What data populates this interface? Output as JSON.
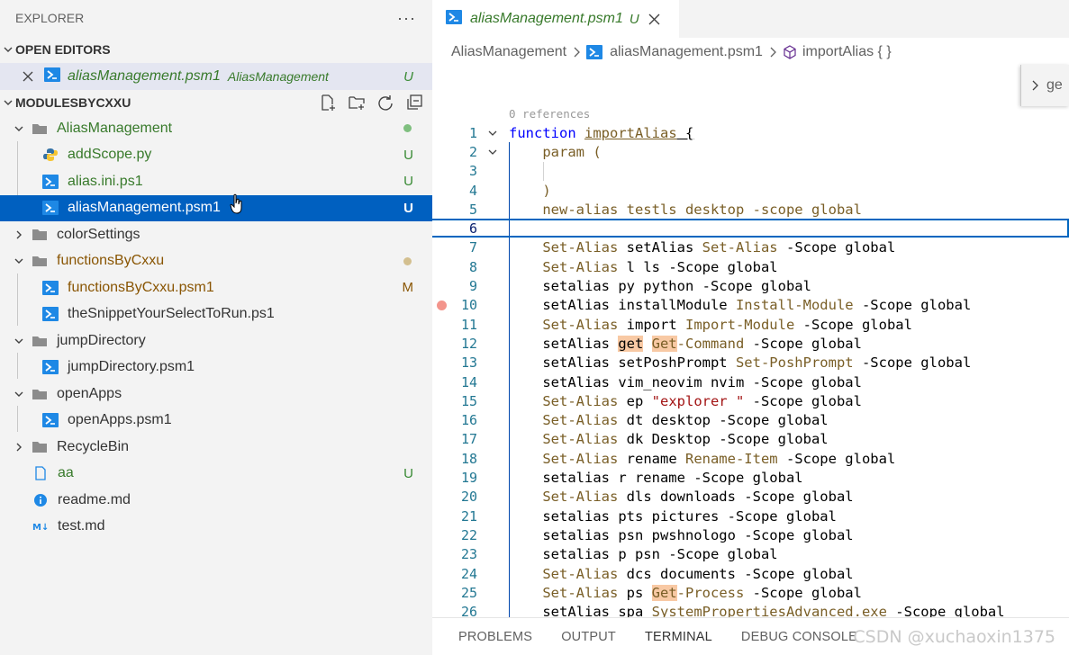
{
  "explorer": {
    "title": "EXPLORER",
    "more_label": "···",
    "open_editors_label": "OPEN EDITORS",
    "open_editor": {
      "name": "aliasManagement.psm1",
      "folder": "AliasManagement",
      "status": "U"
    },
    "workspace_label": "MODULESBYCXXU",
    "tree": [
      {
        "label": "AliasManagement",
        "status": "dot-green"
      },
      {
        "label": "addScope.py",
        "status": "U"
      },
      {
        "label": "alias.ini.ps1",
        "status": "U"
      },
      {
        "label": "aliasManagement.psm1",
        "status": "U"
      },
      {
        "label": "colorSettings"
      },
      {
        "label": "functionsByCxxu",
        "status": "dot-olive"
      },
      {
        "label": "functionsByCxxu.psm1",
        "status": "M"
      },
      {
        "label": "theSnippetYourSelectToRun.ps1"
      },
      {
        "label": "jumpDirectory"
      },
      {
        "label": "jumpDirectory.psm1"
      },
      {
        "label": "openApps"
      },
      {
        "label": "openApps.psm1"
      },
      {
        "label": "RecycleBin"
      },
      {
        "label": "aa",
        "status": "U"
      },
      {
        "label": "readme.md"
      },
      {
        "label": "test.md"
      }
    ],
    "colors": {
      "selected_bg": "#0060c0",
      "added": "#388a34",
      "modified": "#895503"
    }
  },
  "editor": {
    "tab": {
      "name": "aliasManagement.psm1",
      "status": "U"
    },
    "breadcrumb": [
      "AliasManagement",
      "aliasManagement.psm1",
      "importAlias { }"
    ],
    "find_peek_text": "ge",
    "codelens": "0 references",
    "lines": [
      {
        "n": "1"
      },
      {
        "n": "2"
      },
      {
        "n": "3"
      },
      {
        "n": "4"
      },
      {
        "n": "5"
      },
      {
        "n": "6"
      },
      {
        "n": "7"
      },
      {
        "n": "8"
      },
      {
        "n": "9"
      },
      {
        "n": "10"
      },
      {
        "n": "11"
      },
      {
        "n": "12"
      },
      {
        "n": "13"
      },
      {
        "n": "14"
      },
      {
        "n": "15"
      },
      {
        "n": "16"
      },
      {
        "n": "17"
      },
      {
        "n": "18"
      },
      {
        "n": "19"
      },
      {
        "n": "20"
      },
      {
        "n": "21"
      },
      {
        "n": "22"
      },
      {
        "n": "23"
      },
      {
        "n": "24"
      },
      {
        "n": "25"
      },
      {
        "n": "26"
      }
    ],
    "code": {
      "l1_kw": "function",
      "l1_fn": "importAlias",
      "l1_brace": " {",
      "l2": "param (",
      "l4": ")",
      "l5": "new-alias testls desktop -scope global",
      "l7_a": "Set-Alias",
      "l7_b": " setAlias ",
      "l7_c": "Set-Alias",
      "l7_d": " -Scope global",
      "l8_a": "Set-Alias",
      "l8_b": " l ls -Scope global",
      "l9": "setalias py python -Scope global",
      "l10_a": "setAlias installModule ",
      "l10_b": "Install-Module",
      "l10_c": " -Scope global",
      "l11_a": "Set-Alias",
      "l11_b": " import ",
      "l11_c": "Import-Module",
      "l11_d": " -Scope global",
      "l12_a": "setAlias ",
      "l12_b": "get",
      "l12_c": " ",
      "l12_d": "Get",
      "l12_e": "-Command",
      "l12_f": " -Scope global",
      "l13_a": "setAlias setPoshPrompt ",
      "l13_b": "Set-PoshPrompt",
      "l13_c": " -Scope global",
      "l14": "setAlias vim_neovim nvim -Scope global",
      "l15_a": "Set-Alias",
      "l15_b": " ep ",
      "l15_c": "\"explorer \"",
      "l15_d": " -Scope global",
      "l16_a": "Set-Alias",
      "l16_b": " dt desktop -Scope global",
      "l17_a": "Set-Alias",
      "l17_b": " dk Desktop -Scope global",
      "l18_a": "Set-Alias",
      "l18_b": " rename ",
      "l18_c": "Rename-Item",
      "l18_d": " -Scope global",
      "l19": "setalias r rename -Scope global",
      "l20_a": "Set-Alias",
      "l20_b": " dls downloads -Scope global",
      "l21": "setalias pts pictures -Scope global",
      "l22": "setalias psn pwshnologo -Scope global",
      "l23": "setalias p psn -Scope global",
      "l24_a": "Set-Alias",
      "l24_b": " dcs documents -Scope global",
      "l25_a": "Set-Alias",
      "l25_b": " ps ",
      "l25_c": "Get",
      "l25_d": "-Process",
      "l25_e": " -Scope global",
      "l26_a": "setAlias spa ",
      "l26_b": "SystemPropertiesAdvanced.exe",
      "l26_c": " -Scope global"
    }
  },
  "panel": {
    "tabs": [
      "PROBLEMS",
      "OUTPUT",
      "TERMINAL",
      "DEBUG CONSOLE"
    ],
    "active": "TERMINAL"
  },
  "watermark": "CSDN @xuchaoxin1375"
}
